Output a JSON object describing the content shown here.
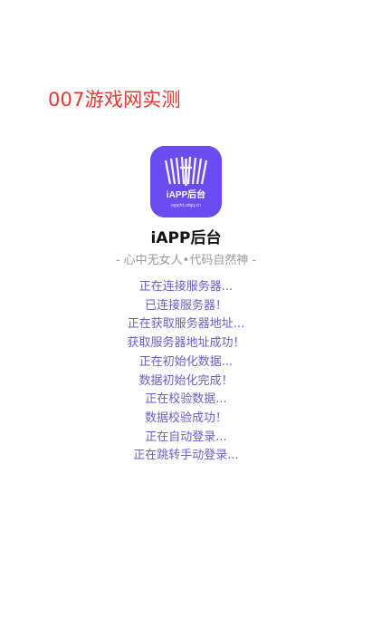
{
  "watermark": "007游戏网实测",
  "logo": {
    "text": "iAPP后台",
    "subtext": "iappht.sdqq.cn",
    "bg_color": "#6b4cf0"
  },
  "app_name": "iAPP后台",
  "slogan": "- 心中无女人•代码自然神 -",
  "status_lines": [
    "正在连接服务器...",
    "已连接服务器！",
    "正在获取服务器地址...",
    "获取服务器地址成功！",
    "正在初始化数据...",
    "数据初始化完成！",
    "正在校验数据...",
    "数据校验成功！",
    "正在自动登录...",
    "正在跳转手动登录..."
  ],
  "colors": {
    "watermark": "#e8362f",
    "status_text": "#6a5fc8",
    "slogan": "#9a9a9a"
  }
}
